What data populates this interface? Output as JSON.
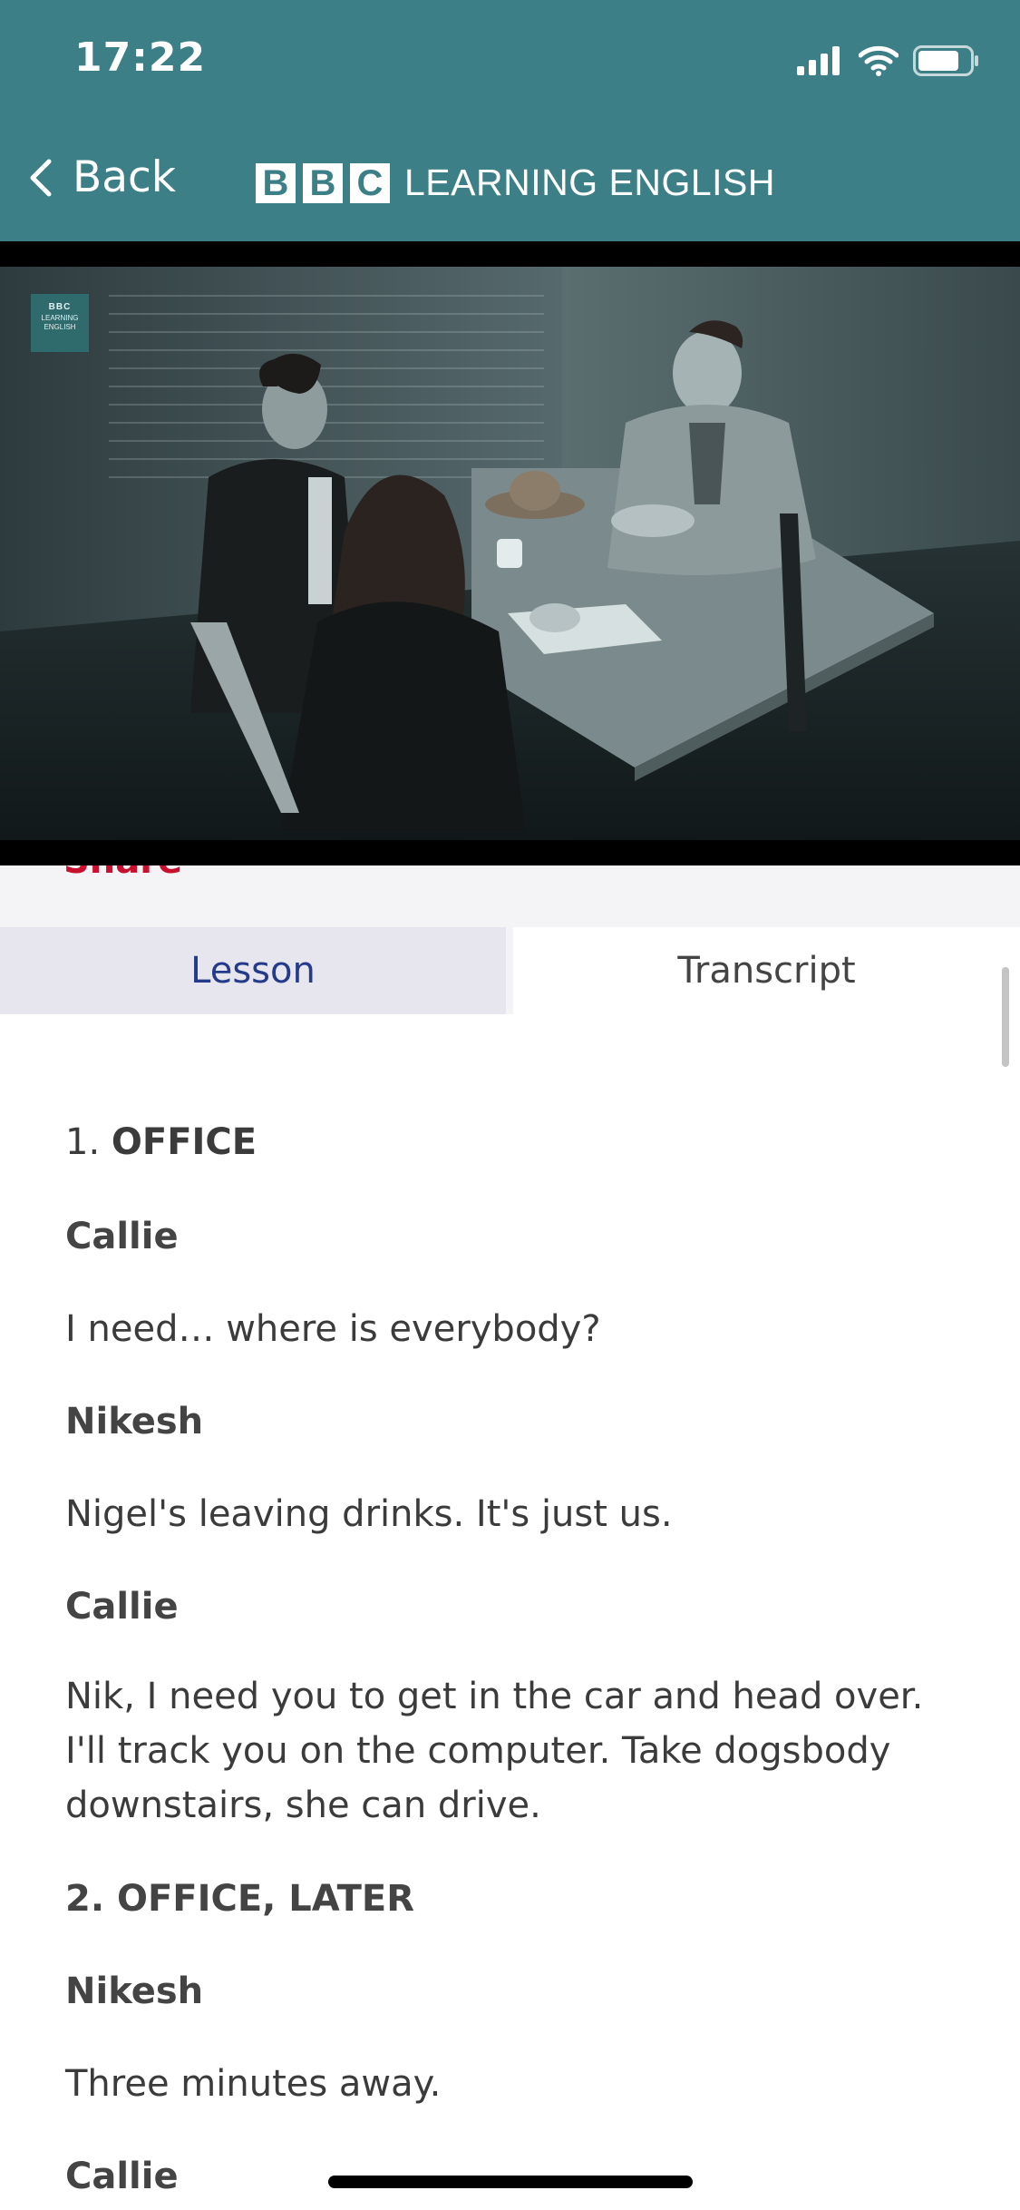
{
  "status_bar": {
    "time": "17:22"
  },
  "nav": {
    "back_label": "Back",
    "brand_letters": [
      "B",
      "B",
      "C"
    ],
    "brand_name": "LEARNING ENGLISH"
  },
  "video": {
    "logo_top": "BBC",
    "logo_bottom": "LEARNING ENGLISH"
  },
  "share": {
    "label": "Share"
  },
  "tabs": [
    {
      "label": "Lesson",
      "selected": false
    },
    {
      "label": "Transcript",
      "selected": true
    }
  ],
  "transcript": {
    "scene1_number": "1.",
    "scene1_title": "OFFICE",
    "speaker1": "Callie",
    "line1": "I need… where is everybody?",
    "speaker2": "Nikesh",
    "line2": "Nigel's leaving drinks. It's just us.",
    "speaker3": "Callie",
    "line3": "Nik, I need you to get in the car and head over. I'll track you on the computer. Take dogsbody downstairs, she can drive.",
    "scene2_title": "2. OFFICE, LATER",
    "speaker4": "Nikesh",
    "line4": "Three minutes away.",
    "speaker5": "Callie"
  },
  "colors": {
    "header_bg": "#3c7f86",
    "tab_selected_text": "#243a8a",
    "share_red": "#c8102e"
  },
  "icons": [
    "signal-icon",
    "wifi-icon",
    "battery-icon",
    "chevron-left-icon"
  ]
}
